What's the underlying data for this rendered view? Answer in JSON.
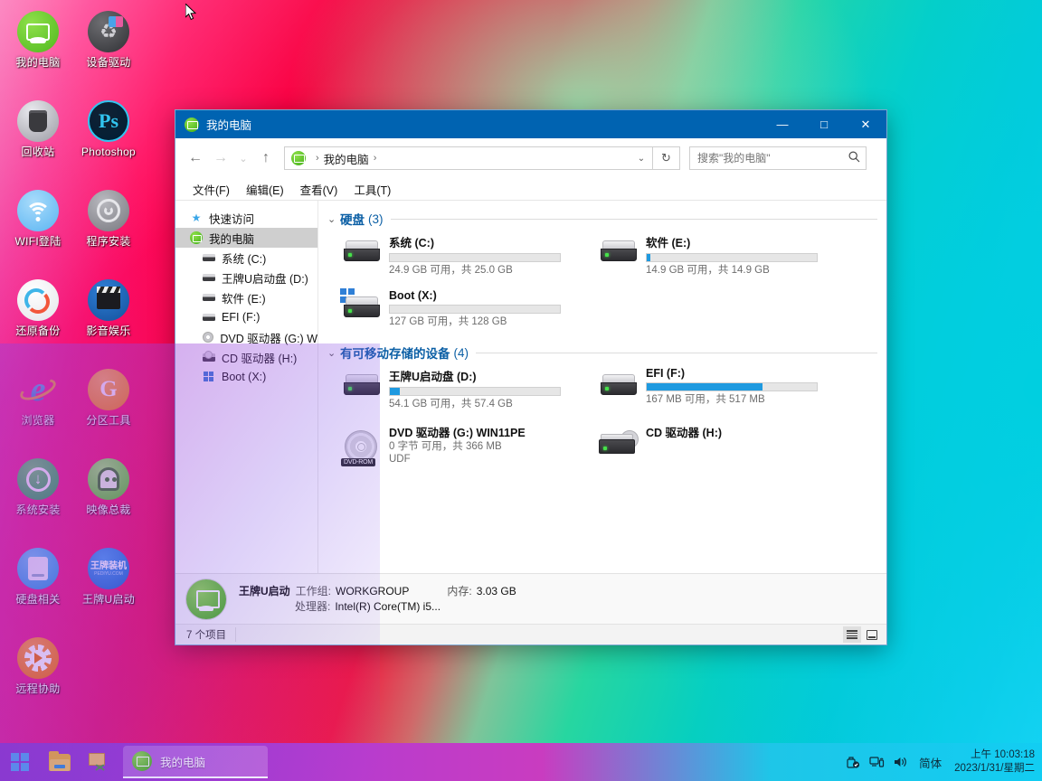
{
  "desktop": {
    "icons": [
      {
        "label": "我的电脑",
        "icon": "my-computer-icon"
      },
      {
        "label": "设备驱动",
        "icon": "device-driver-icon"
      },
      {
        "label": "回收站",
        "icon": "recycle-bin-icon"
      },
      {
        "label": "Photoshop",
        "icon": "photoshop-icon"
      },
      {
        "label": "WIFI登陆",
        "icon": "wifi-login-icon"
      },
      {
        "label": "程序安装",
        "icon": "program-install-icon"
      },
      {
        "label": "还原备份",
        "icon": "restore-backup-icon"
      },
      {
        "label": "影音娱乐",
        "icon": "media-entertainment-icon"
      },
      {
        "label": "浏览器",
        "icon": "browser-icon"
      },
      {
        "label": "分区工具",
        "icon": "partition-tool-icon"
      },
      {
        "label": "系统安装",
        "icon": "system-install-icon"
      },
      {
        "label": "映像总裁",
        "icon": "image-ghost-icon"
      },
      {
        "label": "硬盘相关",
        "icon": "hard-disk-tools-icon"
      },
      {
        "label": "王牌U启动",
        "icon": "wangpai-usb-icon",
        "badge_main": "王牌装机",
        "badge_sub": "PEDIYU.COM"
      },
      {
        "label": "远程协助",
        "icon": "remote-assist-icon"
      }
    ]
  },
  "window": {
    "title": "我的电脑",
    "controls": {
      "minimize": "—",
      "maximize": "□",
      "close": "✕"
    },
    "nav": {
      "back": "←",
      "forward": "→",
      "recent": "⌄",
      "up": "↑",
      "breadcrumb": "我的电脑",
      "breadcrumb_sep": "›",
      "dropdown": "⌄",
      "refresh": "↻"
    },
    "search": {
      "placeholder": "搜索\"我的电脑\"",
      "value": "",
      "icon": "search-icon"
    },
    "menu": [
      "文件(F)",
      "编辑(E)",
      "查看(V)",
      "工具(T)"
    ],
    "tree": [
      {
        "label": "快速访问",
        "icon": "star-icon",
        "indent": false,
        "selected": false
      },
      {
        "label": "我的电脑",
        "icon": "my-computer-icon",
        "indent": false,
        "selected": true
      },
      {
        "label": "系统 (C:)",
        "icon": "drive-icon",
        "indent": true,
        "selected": false
      },
      {
        "label": "王牌U启动盘 (D:)",
        "icon": "drive-icon",
        "indent": true,
        "selected": false
      },
      {
        "label": "软件 (E:)",
        "icon": "drive-icon",
        "indent": true,
        "selected": false
      },
      {
        "label": "EFI (F:)",
        "icon": "drive-icon",
        "indent": true,
        "selected": false
      },
      {
        "label": "DVD 驱动器 (G:) W",
        "icon": "disc-icon",
        "indent": true,
        "selected": false
      },
      {
        "label": "CD 驱动器 (H:)",
        "icon": "cd-drive-icon",
        "indent": true,
        "selected": false
      },
      {
        "label": "Boot (X:)",
        "icon": "windows-drive-icon",
        "indent": true,
        "selected": false
      }
    ],
    "groups": [
      {
        "title": "硬盘",
        "count": "(3)",
        "chevron": "⌄",
        "items": [
          {
            "name": "系统 (C:)",
            "bar": true,
            "fill_pct": 0,
            "sub1": "24.9 GB 可用，共 25.0 GB",
            "sub2": "",
            "icon": "hdd-icon"
          },
          {
            "name": "软件 (E:)",
            "bar": true,
            "fill_pct": 2,
            "sub1": "14.9 GB 可用，共 14.9 GB",
            "sub2": "",
            "icon": "hdd-icon"
          },
          {
            "name": "Boot (X:)",
            "bar": true,
            "fill_pct": 0,
            "sub1": "127 GB 可用，共 128 GB",
            "sub2": "",
            "icon": "windows-hdd-icon"
          }
        ]
      },
      {
        "title": "有可移动存储的设备",
        "count": "(4)",
        "chevron": "⌄",
        "items": [
          {
            "name": "王牌U启动盘 (D:)",
            "bar": true,
            "fill_pct": 6,
            "sub1": "54.1 GB 可用，共 57.4 GB",
            "sub2": "",
            "icon": "hdd-icon"
          },
          {
            "name": "EFI (F:)",
            "bar": true,
            "fill_pct": 68,
            "sub1": "167 MB 可用，共 517 MB",
            "sub2": "",
            "icon": "hdd-icon"
          },
          {
            "name": "DVD 驱动器 (G:) WIN11PE",
            "bar": false,
            "fill_pct": 0,
            "sub1": "0 字节 可用，共 366 MB",
            "sub2": "UDF",
            "icon": "dvd-rom-icon",
            "tag": "DVD-ROM"
          },
          {
            "name": "CD 驱动器 (H:)",
            "bar": false,
            "fill_pct": 0,
            "sub1": "",
            "sub2": "",
            "icon": "cd-drive-icon"
          }
        ]
      }
    ],
    "details": {
      "pc_name": "王牌U启动",
      "workgroup_key": "工作组:",
      "workgroup_value": "WORKGROUP",
      "memory_key": "内存:",
      "memory_value": "3.03 GB",
      "cpu_key": "处理器:",
      "cpu_value": "Intel(R) Core(TM) i5..."
    },
    "status": {
      "count": "7 个项目",
      "view_details": "details-view-icon",
      "view_tiles": "tiles-view-icon"
    }
  },
  "taskbar": {
    "start": "start-icon",
    "pinned": [
      {
        "icon": "file-explorer-icon"
      },
      {
        "icon": "snipping-tool-icon"
      }
    ],
    "active_task": {
      "label": "我的电脑",
      "icon": "my-computer-icon"
    },
    "tray": [
      {
        "icon": "safely-remove-hardware-icon"
      },
      {
        "icon": "network-icon"
      },
      {
        "icon": "volume-icon"
      }
    ],
    "ime": "简体",
    "clock": {
      "time": "上午 10:03:18",
      "date": "2023/1/31/星期二"
    }
  },
  "colors": {
    "title_bar": "#0063b1",
    "accent_blue": "#1f9ae0",
    "group_header": "#0b5fa5",
    "taskbar_left": "#8a35c9",
    "taskbar_right": "#12cdf2"
  }
}
